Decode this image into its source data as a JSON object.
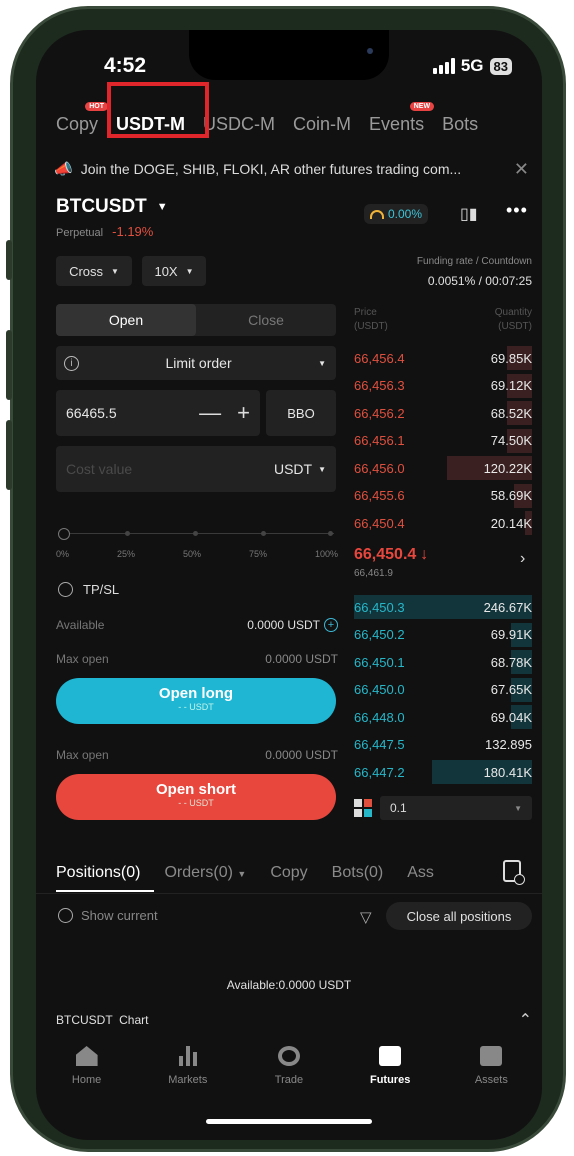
{
  "status": {
    "time": "4:52",
    "network": "5G",
    "battery": "83"
  },
  "tabs": [
    {
      "label": "Copy",
      "badge": "HOT"
    },
    {
      "label": "USDT-M",
      "badge": ""
    },
    {
      "label": "USDC-M",
      "badge": ""
    },
    {
      "label": "Coin-M",
      "badge": ""
    },
    {
      "label": "Events",
      "badge": "NEW"
    },
    {
      "label": "Bots",
      "badge": ""
    }
  ],
  "announcement": "Join the DOGE, SHIB, FLOKI, AR other futures trading com...",
  "pair": {
    "symbol": "BTCUSDT",
    "type": "Perpetual",
    "change": "-1.19%",
    "pct_pill": "0.00%"
  },
  "margin_mode": "Cross",
  "leverage": "10X",
  "funding": {
    "label": "Funding rate / Countdown",
    "value": "0.0051% / 00:07:25"
  },
  "order_panel": {
    "open_tab": "Open",
    "close_tab": "Close",
    "order_type": "Limit order",
    "price": "66465.5",
    "bbo": "BBO",
    "cost_placeholder": "Cost value",
    "cost_unit": "USDT",
    "slider_labels": [
      "0%",
      "25%",
      "50%",
      "75%",
      "100%"
    ],
    "slider_percent": 0,
    "tpsl": "TP/SL",
    "available_label": "Available",
    "available_value": "0.0000 USDT",
    "max_open_label": "Max open",
    "max_open_long": "0.0000 USDT",
    "open_long": "Open long",
    "open_long_sub": "- - USDT",
    "max_open_short": "0.0000 USDT",
    "open_short": "Open short",
    "open_short_sub": "- - USDT"
  },
  "orderbook": {
    "price_header": "Price\n(USDT)",
    "qty_header": "Quantity\n(USDT)",
    "asks": [
      {
        "price": "66,456.4",
        "qty": "69.85K",
        "depth": 0.14
      },
      {
        "price": "66,456.3",
        "qty": "69.12K",
        "depth": 0.14
      },
      {
        "price": "66,456.2",
        "qty": "68.52K",
        "depth": 0.14
      },
      {
        "price": "66,456.1",
        "qty": "74.50K",
        "depth": 0.14
      },
      {
        "price": "66,456.0",
        "qty": "120.22K",
        "depth": 0.48
      },
      {
        "price": "66,455.6",
        "qty": "58.69K",
        "depth": 0.1
      },
      {
        "price": "66,450.4",
        "qty": "20.14K",
        "depth": 0.04
      }
    ],
    "mid_price": "66,450.4",
    "mark_price": "66,461.9",
    "bids": [
      {
        "price": "66,450.3",
        "qty": "246.67K",
        "depth": 1.0
      },
      {
        "price": "66,450.2",
        "qty": "69.91K",
        "depth": 0.12
      },
      {
        "price": "66,450.1",
        "qty": "68.78K",
        "depth": 0.12
      },
      {
        "price": "66,450.0",
        "qty": "67.65K",
        "depth": 0.12
      },
      {
        "price": "66,448.0",
        "qty": "69.04K",
        "depth": 0.12
      },
      {
        "price": "66,447.5",
        "qty": "132.895",
        "depth": 0.0
      },
      {
        "price": "66,447.2",
        "qty": "180.41K",
        "depth": 0.56
      }
    ],
    "depth_step": "0.1"
  },
  "positions": {
    "tabs": [
      "Positions(0)",
      "Orders(0)",
      "Copy",
      "Bots(0)",
      "Ass"
    ],
    "show_current": "Show current",
    "close_all": "Close all positions",
    "available": "Available:0.0000 USDT",
    "chart_label": "BTCUSDT  Chart"
  },
  "nav": [
    {
      "label": "Home",
      "icon": "home-icon"
    },
    {
      "label": "Markets",
      "icon": "markets-icon"
    },
    {
      "label": "Trade",
      "icon": "trade-icon"
    },
    {
      "label": "Futures",
      "icon": "futures-icon"
    },
    {
      "label": "Assets",
      "icon": "assets-icon"
    }
  ],
  "colors": {
    "accent": "#1fb6d3",
    "sell": "#e8473e",
    "highlight": "#e0262a"
  }
}
